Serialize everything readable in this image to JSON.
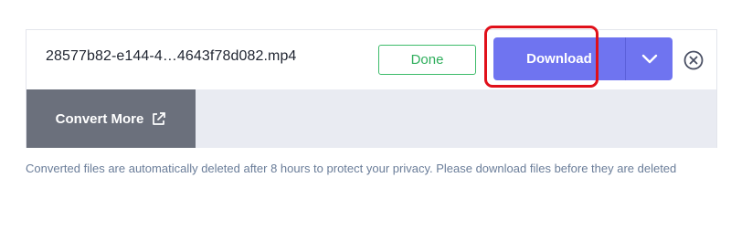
{
  "file": {
    "name": "28577b82-e144-4…4643f78d082.mp4",
    "status": "Done"
  },
  "download": {
    "label": "Download",
    "toggle_icon": "chevron-down-icon",
    "accent": "#6f74f0"
  },
  "close": {
    "icon": "close-circle-icon"
  },
  "convert_more": {
    "label": "Convert More",
    "icon": "external-link-icon"
  },
  "notice": {
    "text": "Converted files are automatically deleted after 8 hours to protect your privacy. Please download files before they are deleted"
  },
  "colors": {
    "highlight": "#e0101a",
    "done": "#2fae5c",
    "convert_bg": "#6b707c"
  }
}
